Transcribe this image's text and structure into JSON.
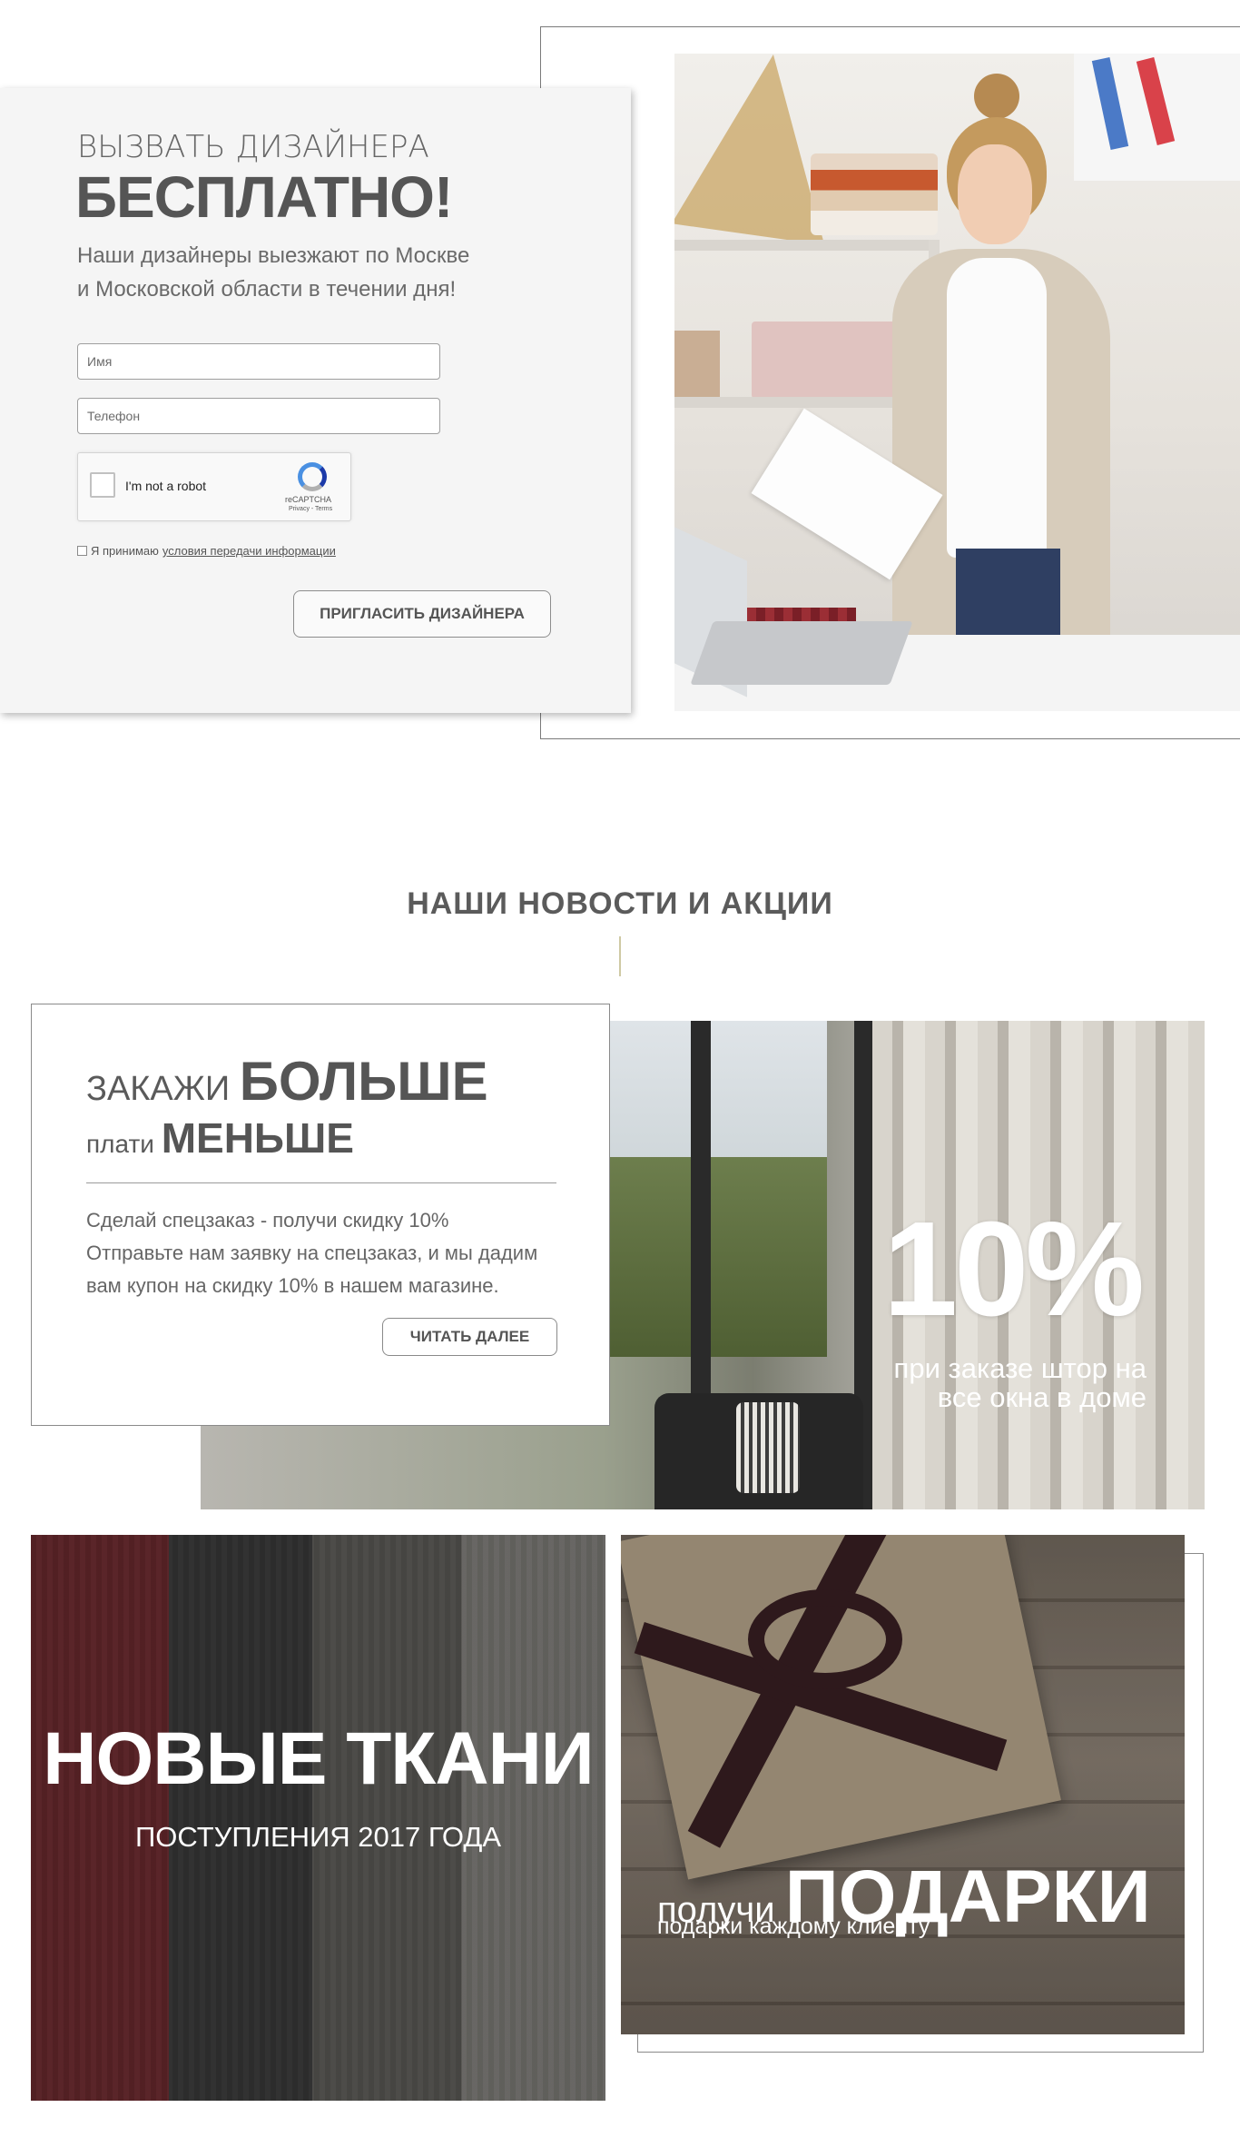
{
  "designer_form": {
    "kicker": "ВЫЗВАТЬ ДИЗАЙНЕРА",
    "headline": "БЕСПЛАТНО!",
    "subtitle_line1": "Наши дизайнеры выезжают по Москве",
    "subtitle_line2": "и Московской области в течении дня!",
    "name_placeholder": "Имя",
    "phone_placeholder": "Телефон",
    "recaptcha": {
      "label": "I'm not a robot",
      "brand": "reCAPTCHA",
      "terms": "Privacy - Terms"
    },
    "consent_text": "Я принимаю",
    "consent_link": "условия передачи информации",
    "submit_label": "ПРИГЛАСИТЬ ДИЗАЙНЕРА"
  },
  "news": {
    "title": "НАШИ НОВОСТИ И АКЦИИ",
    "promo": {
      "line1_light": "ЗАКАЖИ",
      "line1_bold": "БОЛЬШЕ",
      "line2_light": "плати",
      "line2_bold": "МЕНЬШЕ",
      "body_line1": "Сделай спецзаказ - получи скидку 10%",
      "body_line2": "Отправьте нам заявку на спецзаказ, и мы дадим",
      "body_line3": "вам купон на скидку 10% в нашем магазине.",
      "read_more": "ЧИТАТЬ ДАЛЕЕ",
      "percent": "10%",
      "caption_line1": "при заказе штор на",
      "caption_line2": "все окна в доме"
    },
    "fabrics": {
      "title": "НОВЫЕ ТКАНИ",
      "subtitle": "ПОСТУПЛЕНИЯ 2017 ГОДА"
    },
    "gifts": {
      "lead": "получи",
      "title": "ПОДАРКИ",
      "subtitle": "подарки каждому клиенту"
    }
  },
  "colors": {
    "text": "#555555",
    "panel": "#f5f5f5",
    "divider_accent": "#cfc9a4",
    "recaptcha_blue": "#4a90e2"
  },
  "icons": [
    "recaptcha-logo-icon",
    "checkbox-icon"
  ]
}
